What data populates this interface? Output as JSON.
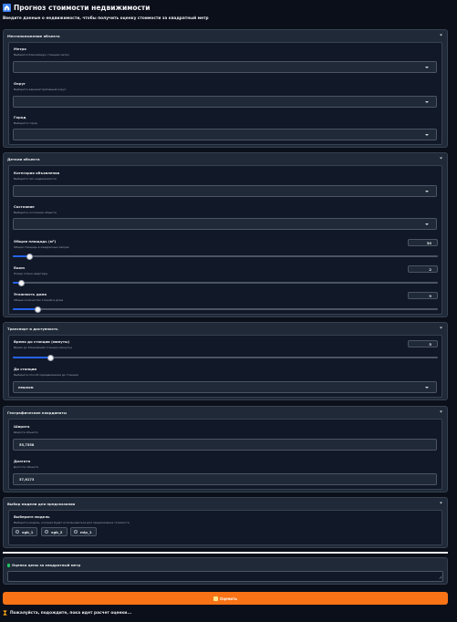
{
  "header": {
    "title": "Прогноз стоимости недвижимости",
    "subtitle": "Введите данные о недвижимости, чтобы получить оценку стоимости за квадратный метр"
  },
  "location": {
    "heading": "Местоположение объекта",
    "metro": {
      "label": "Метро",
      "hint": "Выберите ближайшую станцию метро",
      "value": ""
    },
    "district": {
      "label": "Округ",
      "hint": "Выберите административный округ",
      "value": ""
    },
    "city": {
      "label": "Город",
      "hint": "Выберите город",
      "value": ""
    }
  },
  "details": {
    "heading": "Детали объекта",
    "category": {
      "label": "Категория объявления",
      "hint": "Выберите тип недвижимости",
      "value": ""
    },
    "condition": {
      "label": "Состояние",
      "hint": "Выберите состояние объекта",
      "value": ""
    },
    "area": {
      "label": "Общая площадь (м²)",
      "hint": "Общая площадь в квадратных метрах",
      "value": "30",
      "fraction": 0.04
    },
    "rooms": {
      "label": "Room",
      "hint": "Номер этажа квартиры",
      "value": "2",
      "fraction": 0.02
    },
    "floors": {
      "label": "Этажность дома",
      "hint": "Общее количество этажей в доме",
      "value": "9",
      "fraction": 0.06
    }
  },
  "transport": {
    "heading": "Транспорт и доступность",
    "time": {
      "label": "Время до станции (минуты)",
      "hint": "Время до ближайшей станции (минуты)",
      "value": "5",
      "fraction": 0.09
    },
    "to_station": {
      "label": "До станции",
      "hint": "Выберите способ передвижения до станции",
      "value": "пешком"
    }
  },
  "coords": {
    "heading": "Географические координаты",
    "lat": {
      "label": "Широта",
      "hint": "Широта объекта",
      "value": "55,7558"
    },
    "lon": {
      "label": "Долгота",
      "hint": "Долгота объекта",
      "value": "37,6173"
    }
  },
  "model": {
    "heading": "Выбор модели для предсказания",
    "label": "Выберите модель",
    "hint": "Выберите модель, которая будет использоваться для предсказания стоимости",
    "options": [
      "xgb_1",
      "xgb_2",
      "mlp_1"
    ]
  },
  "output": {
    "label": "Оценка цены за квадратный метр",
    "value": ""
  },
  "button": {
    "label": "Оценить"
  },
  "status": {
    "text": "Пожалуйста, подождите, пока идет расчет оценки..."
  },
  "colors": {
    "accent": "#f97316",
    "slider": "#2563eb",
    "background": "#0b0f19",
    "panel": "#1f2937"
  }
}
